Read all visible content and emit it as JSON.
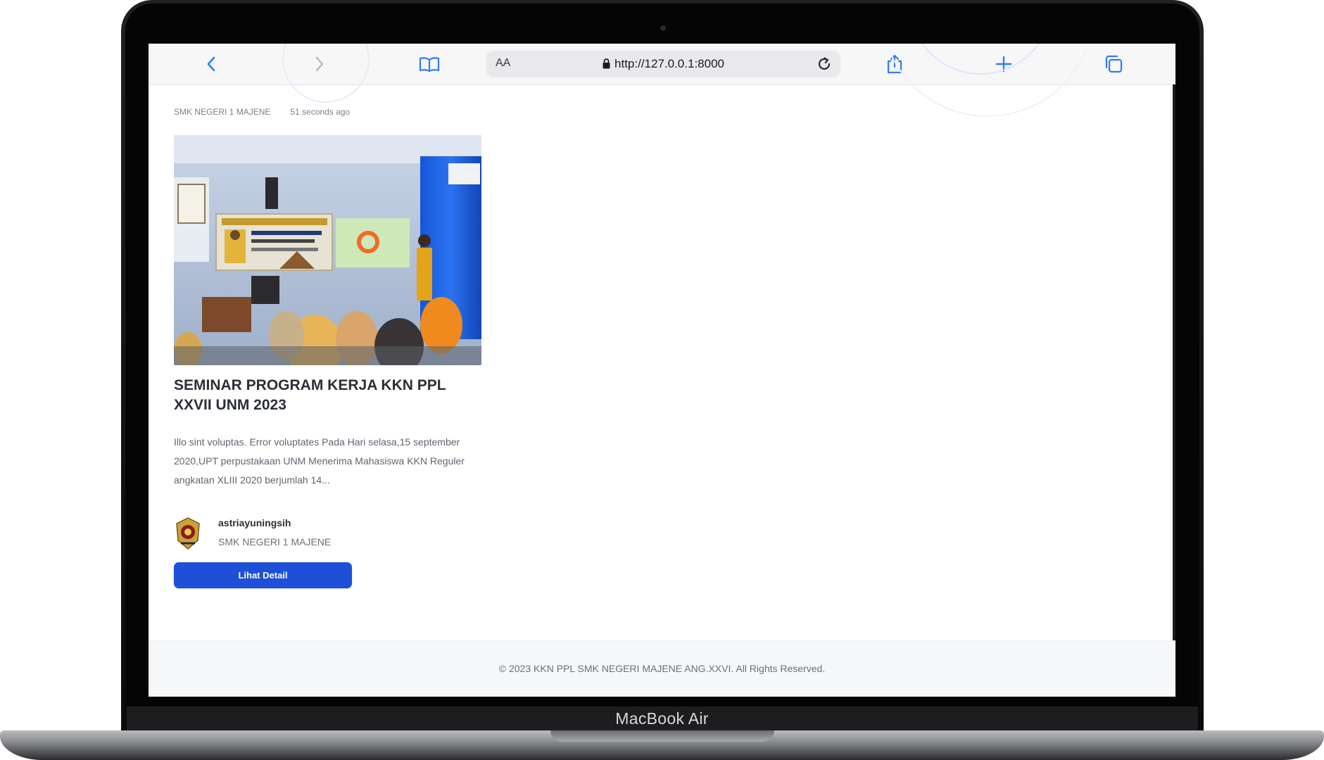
{
  "device": {
    "model_label": "MacBook Air"
  },
  "browser": {
    "text_size_label": "AA",
    "url": "http://127.0.0.1:8000",
    "icons": [
      "back-icon",
      "forward-icon",
      "bookmarks-icon",
      "lock-icon",
      "reload-icon",
      "share-icon",
      "new-tab-icon",
      "tabs-icon"
    ]
  },
  "post": {
    "source": "SMK NEGERI 1 MAJENE",
    "time_ago": "51 seconds ago",
    "title": "SEMINAR PROGRAM KERJA KKN PPL XXVII UNM 2023",
    "excerpt": "Illo sint voluptas. Error voluptates Pada Hari selasa,15 september 2020,UPT perpustakaan UNM Menerima Mahasiswa KKN Reguler angkatan XLIII 2020 berjumlah 14...",
    "author": "astriayuningsih",
    "author_school": "SMK NEGERI 1 MAJENE",
    "detail_button": "Lihat Detail"
  },
  "footer": {
    "copyright": "© 2023 KKN PPL SMK NEGERI MAJENE ANG.XXVI. All Rights Reserved."
  },
  "colors": {
    "accent": "#1e4fd8",
    "toolbar_icon": "#2f7cf6"
  }
}
